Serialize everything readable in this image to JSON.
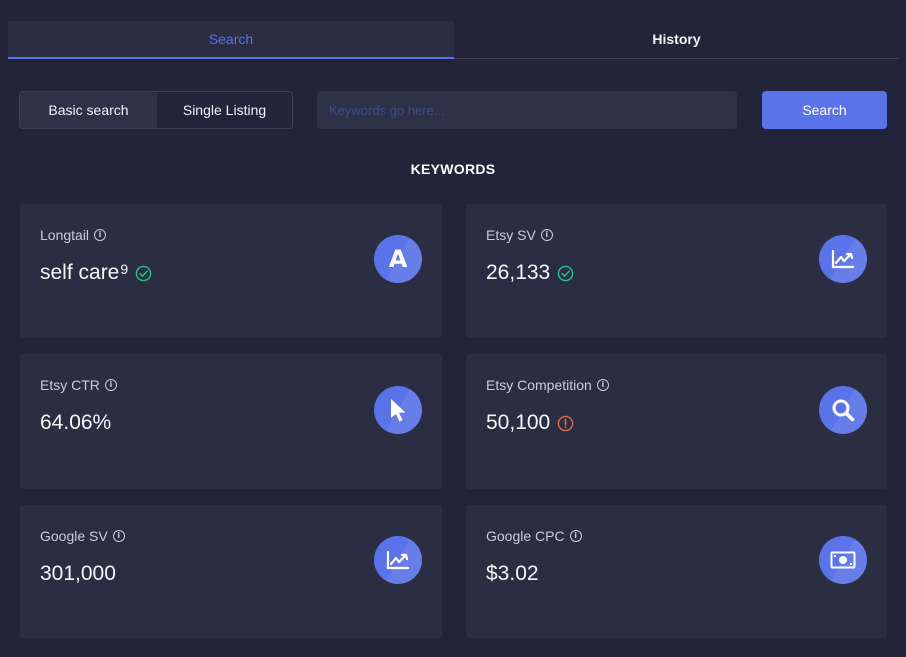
{
  "tabs": {
    "search": "Search",
    "history": "History"
  },
  "mode": {
    "basic": "Basic search",
    "single": "Single Listing"
  },
  "search": {
    "placeholder": "Keywords go here...",
    "button": "Search"
  },
  "section_title": "KEYWORDS",
  "cards": {
    "longtail": {
      "label": "Longtail",
      "value": "self care",
      "count": "9",
      "status": "check",
      "icon": "letter-a-icon",
      "icon_text": "A"
    },
    "etsy_sv": {
      "label": "Etsy SV",
      "value": "26,133",
      "status": "check",
      "icon": "trend-chart-icon"
    },
    "etsy_ctr": {
      "label": "Etsy CTR",
      "value": "64.06%",
      "icon": "cursor-icon"
    },
    "etsy_competition": {
      "label": "Etsy Competition",
      "value": "50,100",
      "status": "warning",
      "icon": "search-icon"
    },
    "google_sv": {
      "label": "Google SV",
      "value": "301,000",
      "icon": "trend-chart-icon"
    },
    "google_cpc": {
      "label": "Google CPC",
      "value": "$3.02",
      "icon": "money-icon"
    }
  },
  "colors": {
    "accent": "#5b73e8",
    "success": "#22c58b",
    "warning": "#e0684b",
    "background": "#22253a",
    "card": "#2b2e42"
  }
}
